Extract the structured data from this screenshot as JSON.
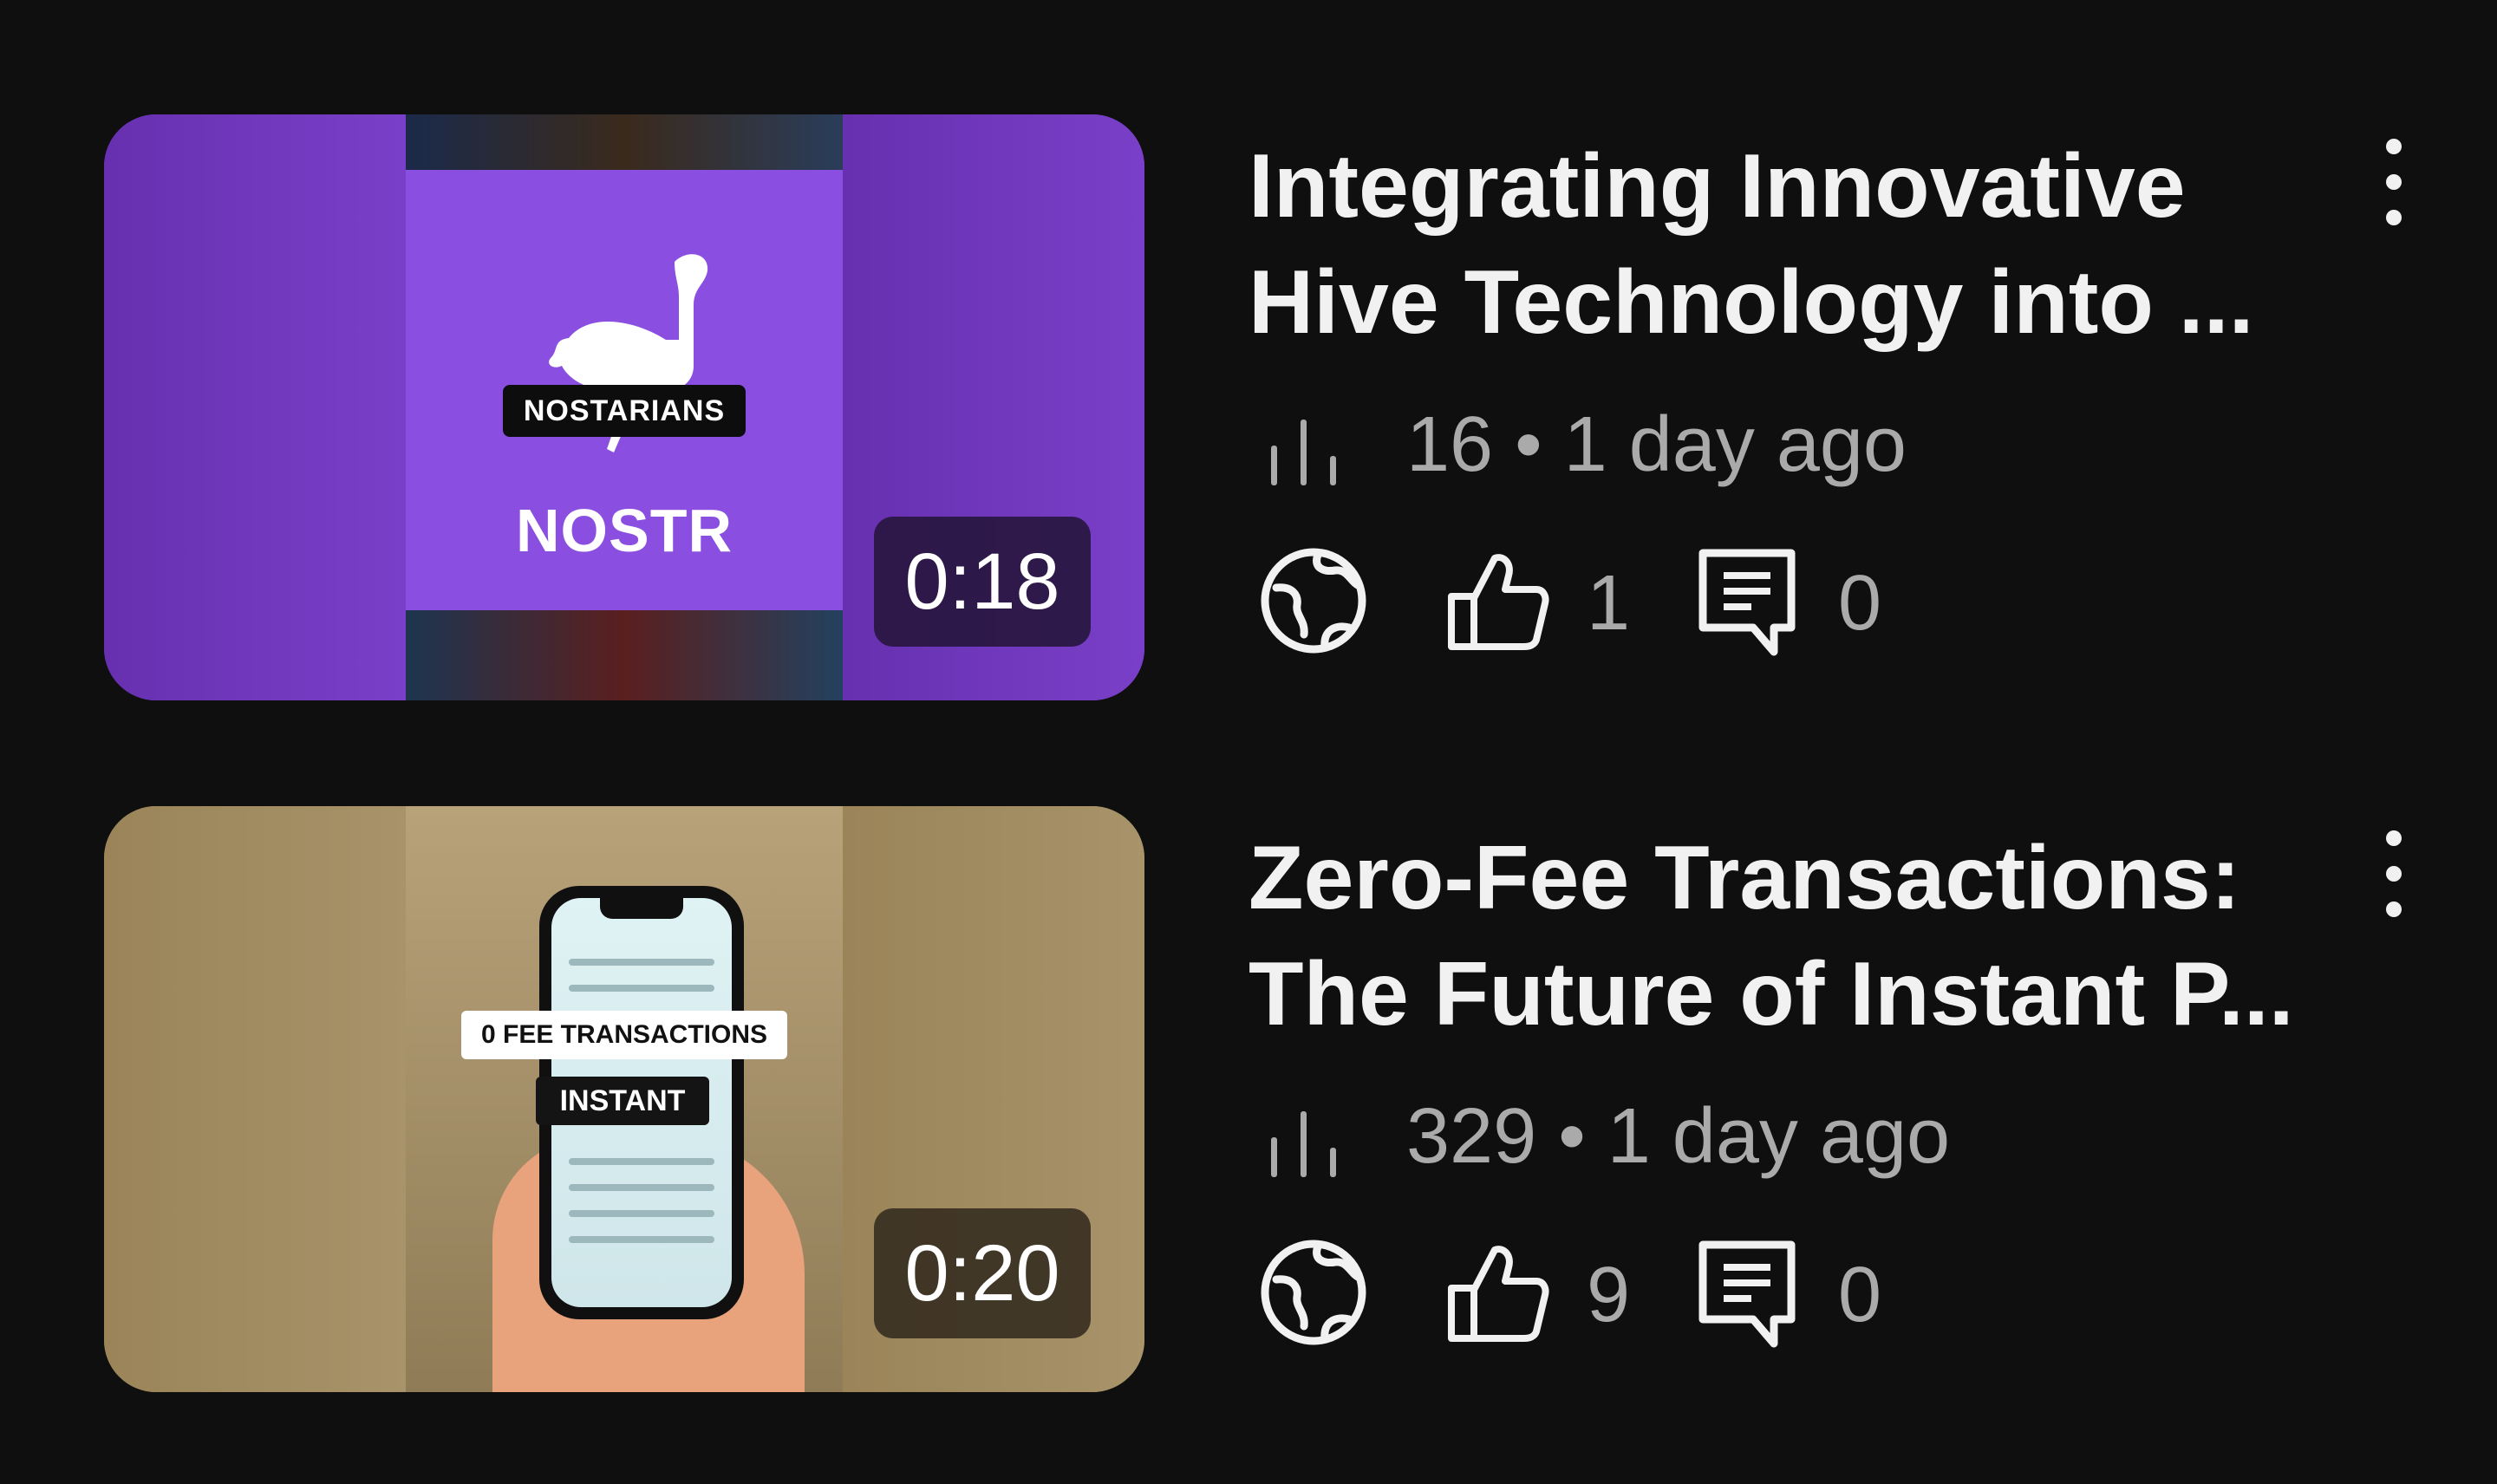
{
  "videos": [
    {
      "thumbnail": {
        "tag": "NOSTARIANS",
        "headline": "NOSTR",
        "duration": "0:18"
      },
      "title": "Integrating Innovative\nHive Technology into ...",
      "views": "16",
      "separator": "•",
      "age": "1 day ago",
      "visibility_icon": "globe-icon",
      "likes": "1",
      "comments": "0"
    },
    {
      "thumbnail": {
        "tag": "0 FEE TRANSACTIONS",
        "headline": "INSTANT",
        "duration": "0:20"
      },
      "title": "Zero-Fee Transactions:\nThe Future of Instant P...",
      "views": "329",
      "separator": "•",
      "age": "1 day ago",
      "visibility_icon": "globe-icon",
      "likes": "9",
      "comments": "0"
    }
  ],
  "colors": {
    "background": "#0f0f0f",
    "title": "#f1f1f1",
    "meta": "#aaaaaa",
    "nostr_purple": "#8a4fe0"
  }
}
